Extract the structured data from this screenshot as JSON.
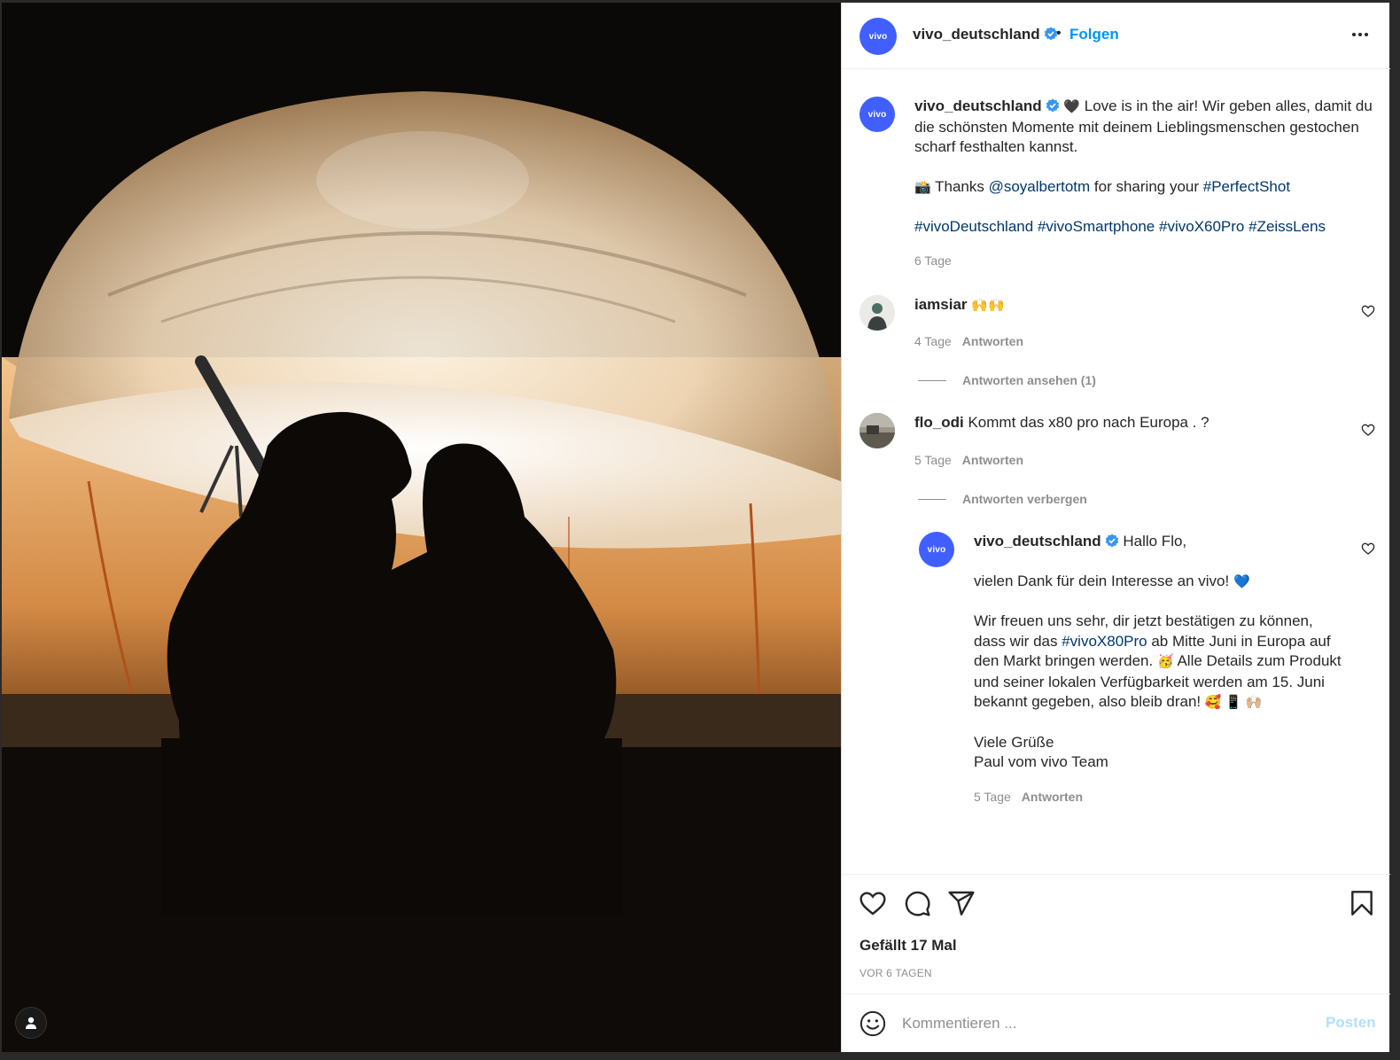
{
  "post": {
    "author": "vivo_deutschland",
    "avatar_text": "vivo",
    "follow_label": "Folgen",
    "separator": "•"
  },
  "caption": {
    "author": "vivo_deutschland",
    "heart": "🖤",
    "text_1": "Love is in the air! Wir geben alles, damit du die schönsten Momente mit deinem Lieblingsmenschen gestochen scharf festhalten kannst.",
    "camera": "📸",
    "thanks": "Thanks",
    "mention": "@soyalbertotm",
    "for_sharing": "for sharing your",
    "hashtag_perfect": "#PerfectShot",
    "hashtags": [
      "#vivoDeutschland",
      "#vivoSmartphone",
      "#vivoX60Pro",
      "#ZeissLens"
    ],
    "time": "6 Tage"
  },
  "comments": [
    {
      "user": "iamsiar",
      "text": "🙌🙌",
      "time": "4 Tage",
      "reply_label": "Antworten",
      "view_replies": "Antworten ansehen (1)"
    },
    {
      "user": "flo_odi",
      "text": "Kommt das x80 pro nach Europa . ?",
      "time": "5 Tage",
      "reply_label": "Antworten",
      "hide_replies": "Antworten verbergen"
    }
  ],
  "reply": {
    "user": "vivo_deutschland",
    "greeting": "Hallo Flo,",
    "line_2": "vielen Dank für dein Interesse an vivo!",
    "blue_heart": "💙",
    "para_3a": "Wir freuen uns sehr, dir jetzt bestätigen zu können, dass wir das",
    "hashtag_x80": "#vivoX80Pro",
    "para_3b": "ab Mitte Juni in Europa auf den Markt bringen werden.",
    "party": "🥳",
    "para_3c": "Alle Details zum Produkt und seiner lokalen Verfügbarkeit werden am 15. Juni bekannt gegeben, also bleib dran!",
    "emoji_end": "🥰 📱 🙌🏼",
    "sign_1": "Viele Grüße",
    "sign_2": "Paul vom vivo Team",
    "time": "5 Tage",
    "reply_label": "Antworten"
  },
  "footer": {
    "likes": "Gefällt 17 Mal",
    "date": "VOR 6 TAGEN",
    "comment_placeholder": "Kommentieren ...",
    "post_label": "Posten"
  },
  "colors": {
    "accent": "#0095f6",
    "link": "#00376b",
    "vivo_blue": "#415fff",
    "muted": "#8e8e8e"
  },
  "icons": [
    "more-options-icon",
    "verified-badge-icon",
    "heart-icon",
    "comment-icon",
    "share-icon",
    "bookmark-icon",
    "emoji-icon",
    "user-tag-icon"
  ]
}
